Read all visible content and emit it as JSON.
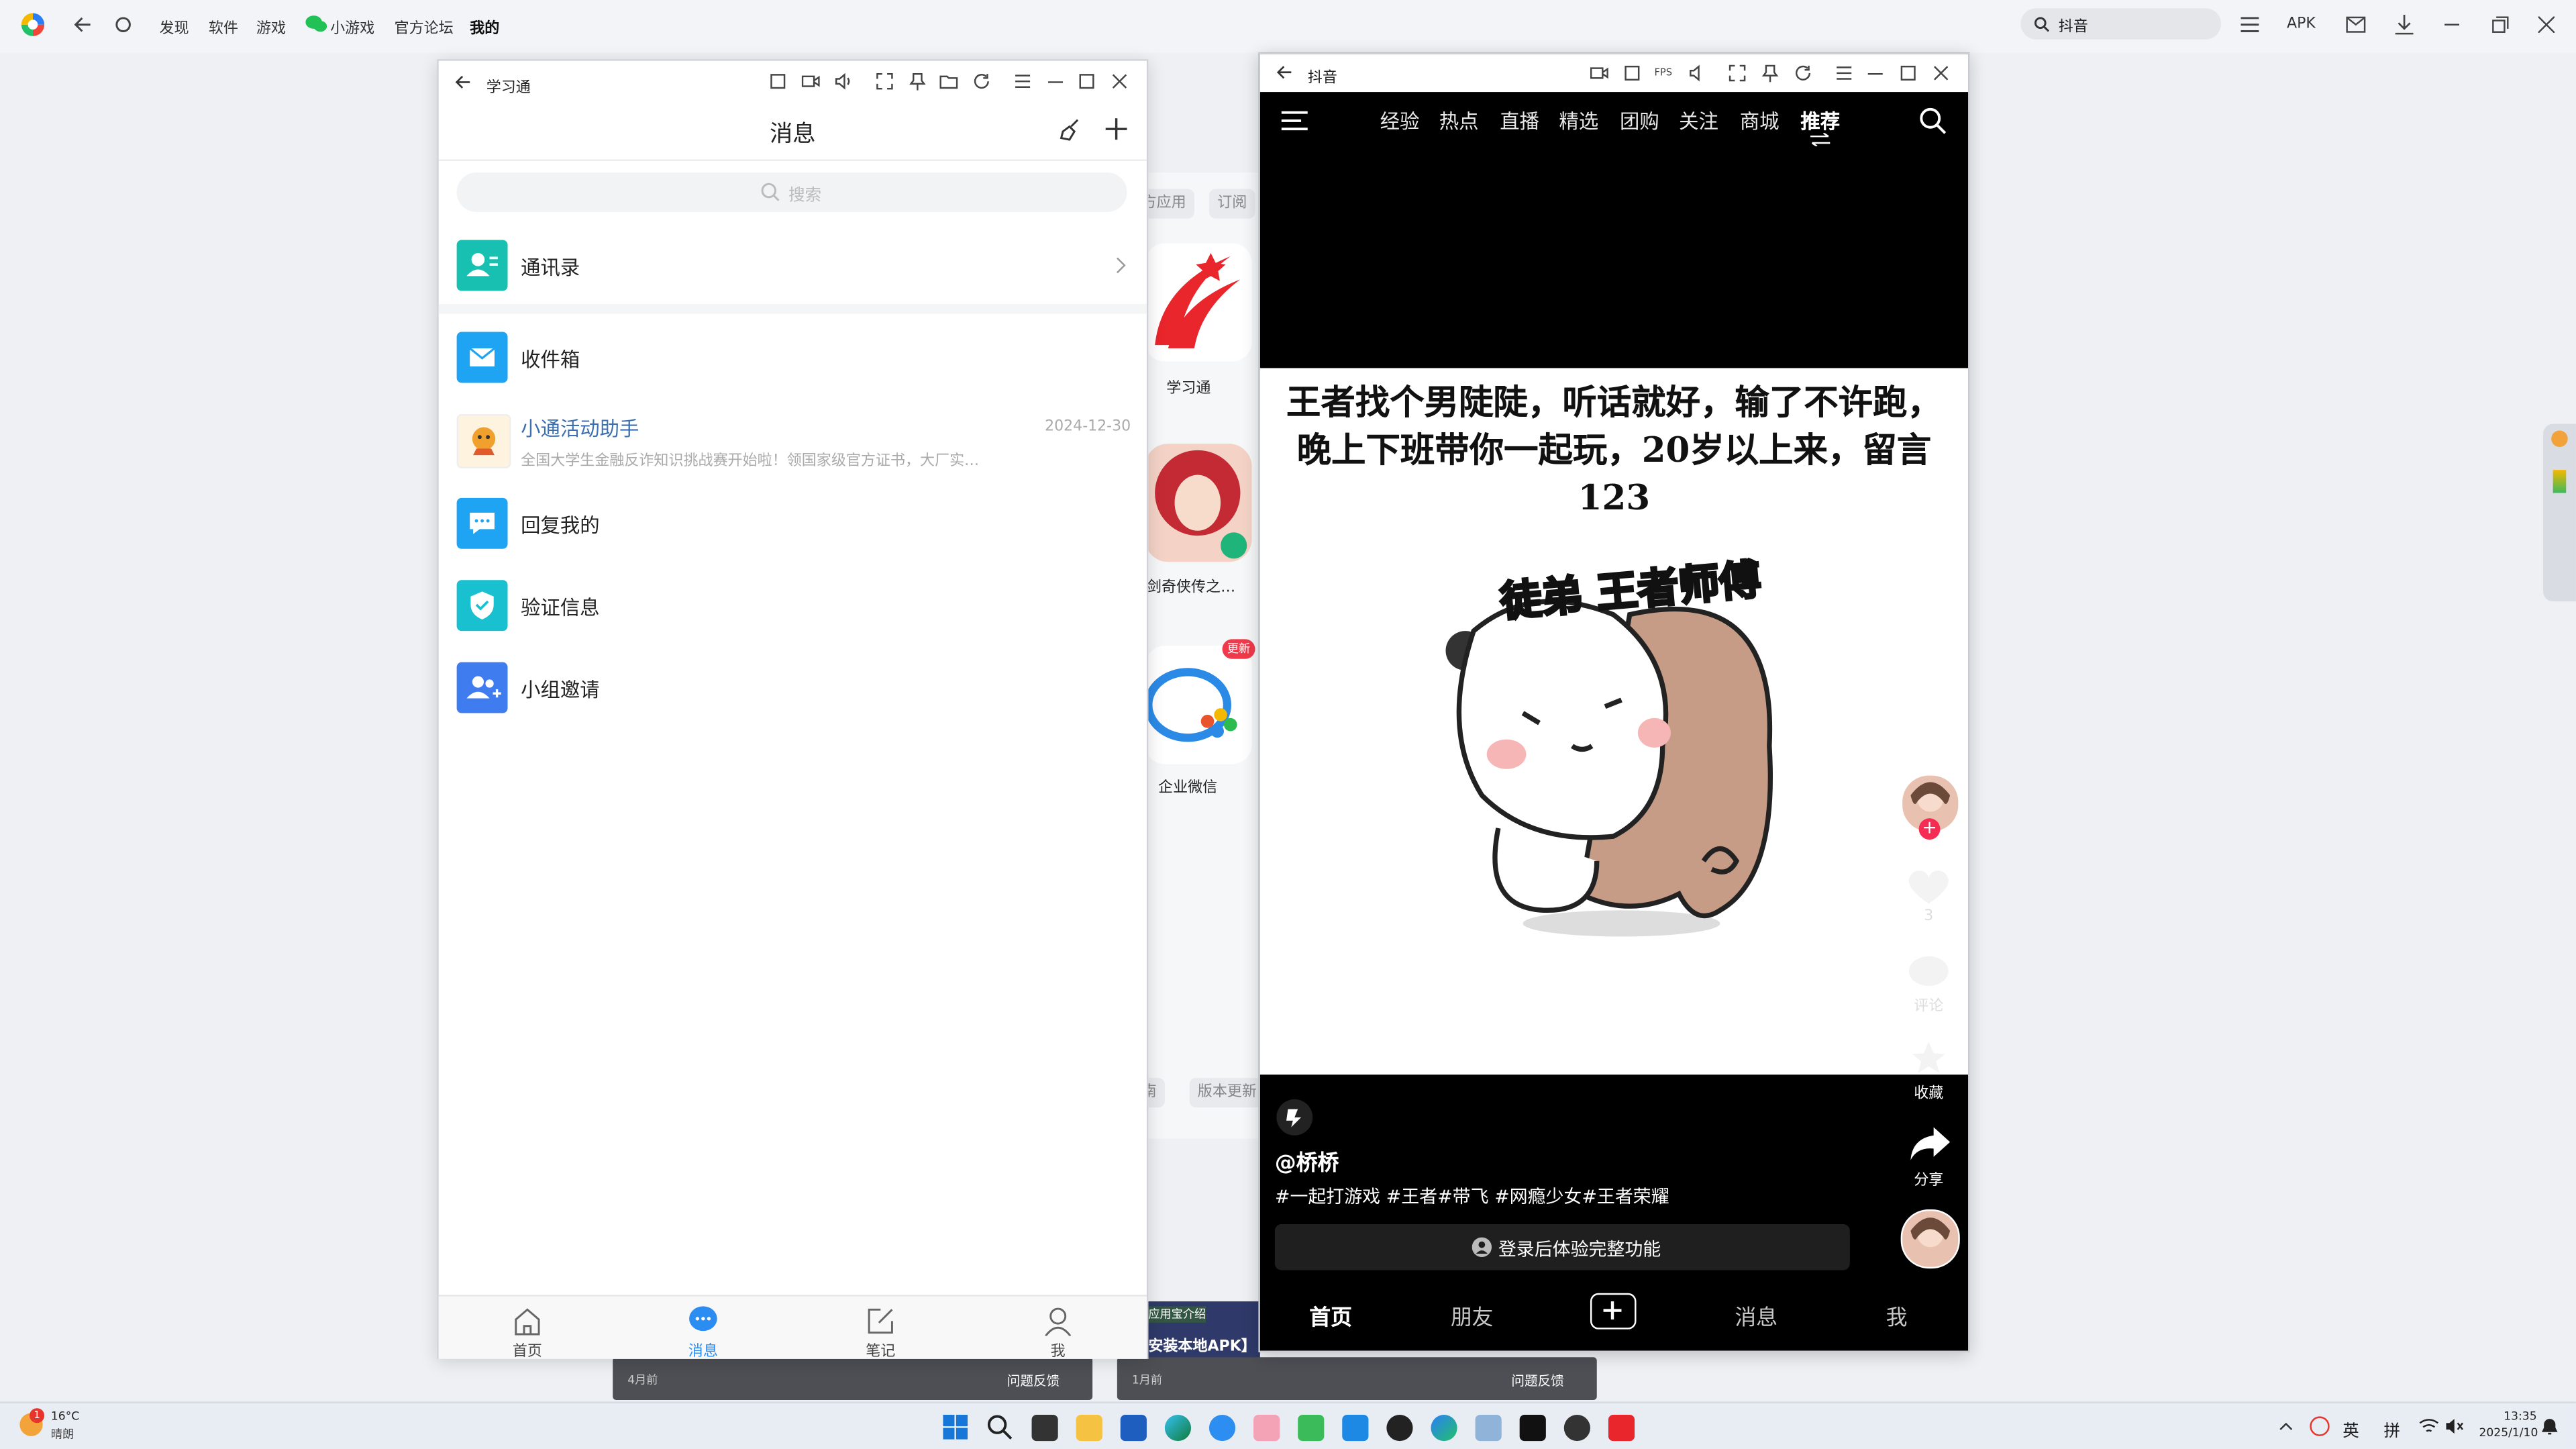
{
  "browser": {
    "nav": [
      "发现",
      "软件",
      "游戏",
      "小游戏",
      "官方论坛",
      "我的"
    ],
    "search_value": "抖音",
    "apk_label": "APK"
  },
  "bg_app": {
    "chips": [
      "方应用",
      "订阅"
    ],
    "apps": [
      "学习通",
      "剑奇侠传之…",
      "企业微信"
    ],
    "update_badge": "更新",
    "bottom_chips": [
      "南",
      "版本更新"
    ],
    "card1_time": "4月前",
    "card2_time": "1月前",
    "feedback": "问题反馈",
    "card2_tag": "应用宝介绍",
    "card2_text": "安装本地APK】"
  },
  "xxt": {
    "window_title": "学习通",
    "page_title": "消息",
    "search_placeholder": "搜索",
    "rows": [
      {
        "label": "通讯录"
      },
      {
        "label": "收件箱"
      },
      {
        "label": "小通活动助手",
        "date": "2024-12-30",
        "preview": "全国大学生金融反诈知识挑战赛开始啦！领国家级官方证书，大厂实…"
      },
      {
        "label": "回复我的"
      },
      {
        "label": "验证信息"
      },
      {
        "label": "小组邀请"
      }
    ],
    "tabs": [
      "首页",
      "消息",
      "笔记",
      "我"
    ],
    "colors": {
      "accent": "#2b8cf2",
      "teal": "#18c0b2",
      "blue": "#1fa3f3",
      "indigo": "#3e7cf0"
    }
  },
  "douyin": {
    "window_title": "抖音",
    "top_tabs": [
      "经验",
      "热点",
      "直播",
      "精选",
      "团购",
      "关注",
      "商城",
      "推荐"
    ],
    "caption": "王者找个男陡陡，听话就好，输了不许跑，晚上下班带你一起玩，20岁以上来，留言123",
    "sticker_text": "徒弟 王者师傅",
    "like_count": "3",
    "comment_label": "评论",
    "collect_label": "收藏",
    "share_label": "分享",
    "author": "@桥桥",
    "tags": "#一起打游戏 #王者#带飞 #网瘾少女#王者荣耀",
    "login_text": "登录后体验完整功能",
    "bottom_tabs": [
      "首页",
      "朋友",
      "消息",
      "我"
    ],
    "fps_label": "FPS"
  },
  "taskbar": {
    "weather_temp": "16°C",
    "weather_desc": "晴朗",
    "weather_badge": "1",
    "ime_lang": "英",
    "ime_mode": "拼",
    "time": "13:35",
    "date": "2025/1/10"
  }
}
